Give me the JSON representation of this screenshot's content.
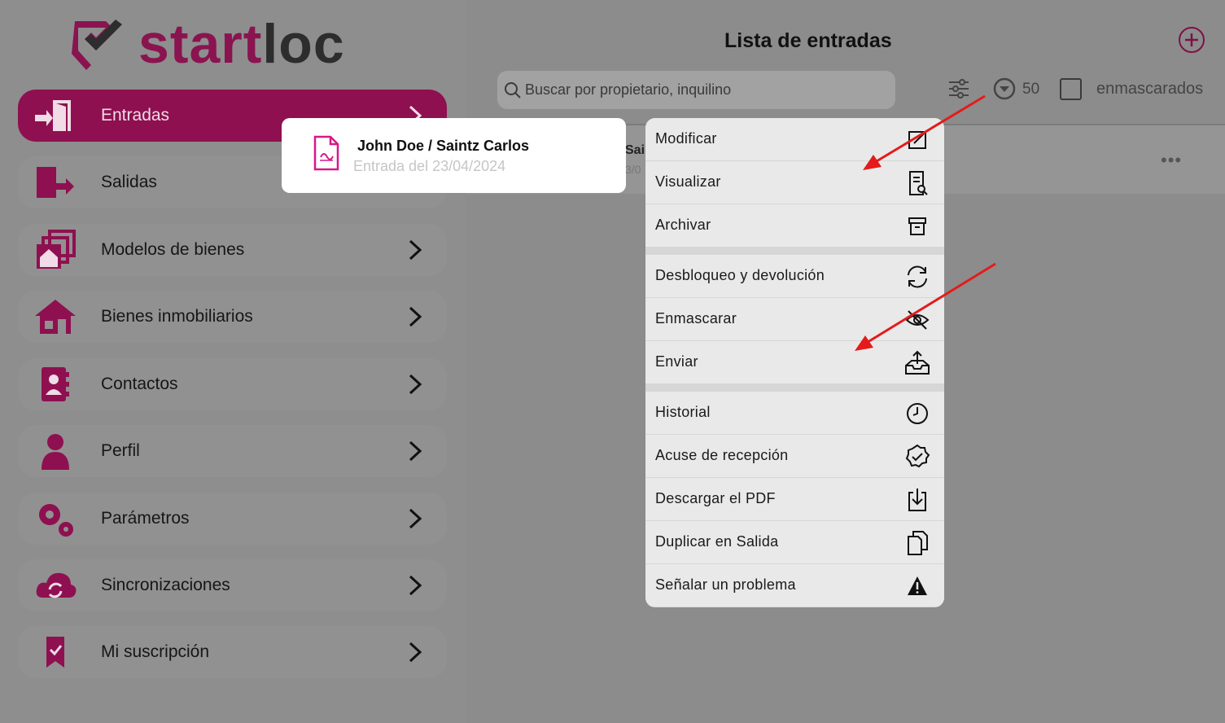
{
  "brand": {
    "part1": "start",
    "part2": "loc"
  },
  "sidebar": {
    "items": [
      {
        "label": "Entradas",
        "icon": "door-enter-icon"
      },
      {
        "label": "Salidas",
        "icon": "door-exit-icon"
      },
      {
        "label": "Modelos de bienes",
        "icon": "house-stack-icon"
      },
      {
        "label": "Bienes inmobiliarios",
        "icon": "house-icon"
      },
      {
        "label": "Contactos",
        "icon": "contact-book-icon"
      },
      {
        "label": "Perfil",
        "icon": "person-icon"
      },
      {
        "label": "Parámetros",
        "icon": "gears-icon"
      },
      {
        "label": "Sincronizaciones",
        "icon": "cloud-sync-icon"
      },
      {
        "label": "Mi suscripción",
        "icon": "bookmark-check-icon"
      }
    ]
  },
  "header": {
    "title": "Lista de entradas",
    "search_placeholder": "Buscar por propietario, inquilino",
    "count": "50",
    "mask_label": "enmascarados"
  },
  "list": {
    "row_title_partial": "Sai",
    "row_sub_partial": "3/0"
  },
  "card": {
    "title": "John Doe / Saintz Carlos",
    "subtitle": "Entrada del 23/04/2024"
  },
  "actions": [
    {
      "label": "Modificar",
      "icon": "edit-icon"
    },
    {
      "label": "Visualizar",
      "icon": "document-search-icon"
    },
    {
      "label": "Archivar",
      "icon": "archive-icon"
    },
    {
      "label": "Desbloqueo y devolución",
      "icon": "refresh-icon"
    },
    {
      "label": "Enmascarar",
      "icon": "eye-off-icon"
    },
    {
      "label": "Enviar",
      "icon": "send-tray-icon"
    },
    {
      "label": "Historial",
      "icon": "clock-icon"
    },
    {
      "label": "Acuse de recepción",
      "icon": "badge-check-icon"
    },
    {
      "label": "Descargar el PDF",
      "icon": "download-icon"
    },
    {
      "label": "Duplicar en Salida",
      "icon": "copy-icon"
    },
    {
      "label": "Señalar un problema",
      "icon": "warning-icon"
    }
  ],
  "colors": {
    "brand": "#8e1050",
    "annotation_arrow": "#e41b1b"
  }
}
